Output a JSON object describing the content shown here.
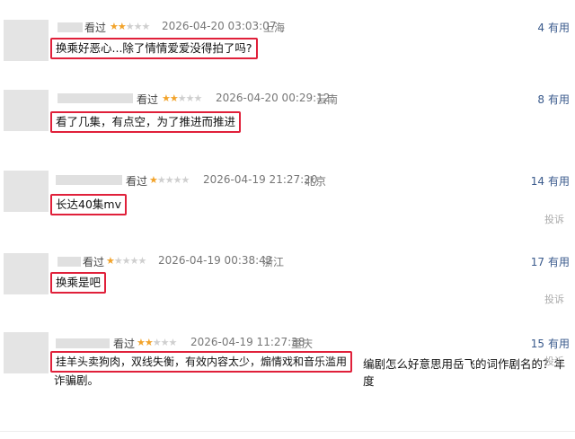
{
  "reviews": [
    {
      "status": "看过",
      "stars": 2,
      "time": "2026-04-20 03:03:07",
      "location": "上海",
      "useful_count": "4",
      "useful_label": "有用",
      "comment": "换乘好恶心...除了情情爱爱没得拍了吗?",
      "report": ""
    },
    {
      "status": "看过",
      "stars": 2,
      "time": "2026-04-20 00:29:12",
      "location": "云南",
      "useful_count": "8",
      "useful_label": "有用",
      "comment": "看了几集，有点空，为了推进而推进",
      "report": ""
    },
    {
      "status": "看过",
      "stars": 1,
      "time": "2026-04-19 21:27:20",
      "location": "北京",
      "useful_count": "14",
      "useful_label": "有用",
      "comment": "长达40集mv",
      "report": "投诉"
    },
    {
      "status": "看过",
      "stars": 1,
      "time": "2026-04-19 00:38:42",
      "location": "浙江",
      "useful_count": "17",
      "useful_label": "有用",
      "comment": "换乘是吧",
      "report": "投诉"
    },
    {
      "status": "看过",
      "stars": 2,
      "time": "2026-04-19 11:27:38",
      "location": "重庆",
      "useful_count": "15",
      "useful_label": "有用",
      "comment": "挂羊头卖狗肉，双线失衡，有效内容太少，煽情戏和音乐滥用",
      "report": "投诉",
      "extra_line1": "编剧怎么好意思用岳飞的词作剧名的？年度",
      "extra_line2": "诈骗剧。"
    }
  ],
  "colors": {
    "highlight": "#e0203a",
    "star_on": "#f2a32a",
    "star_off": "#cfcfcf",
    "useful": "#3a5a8c"
  }
}
